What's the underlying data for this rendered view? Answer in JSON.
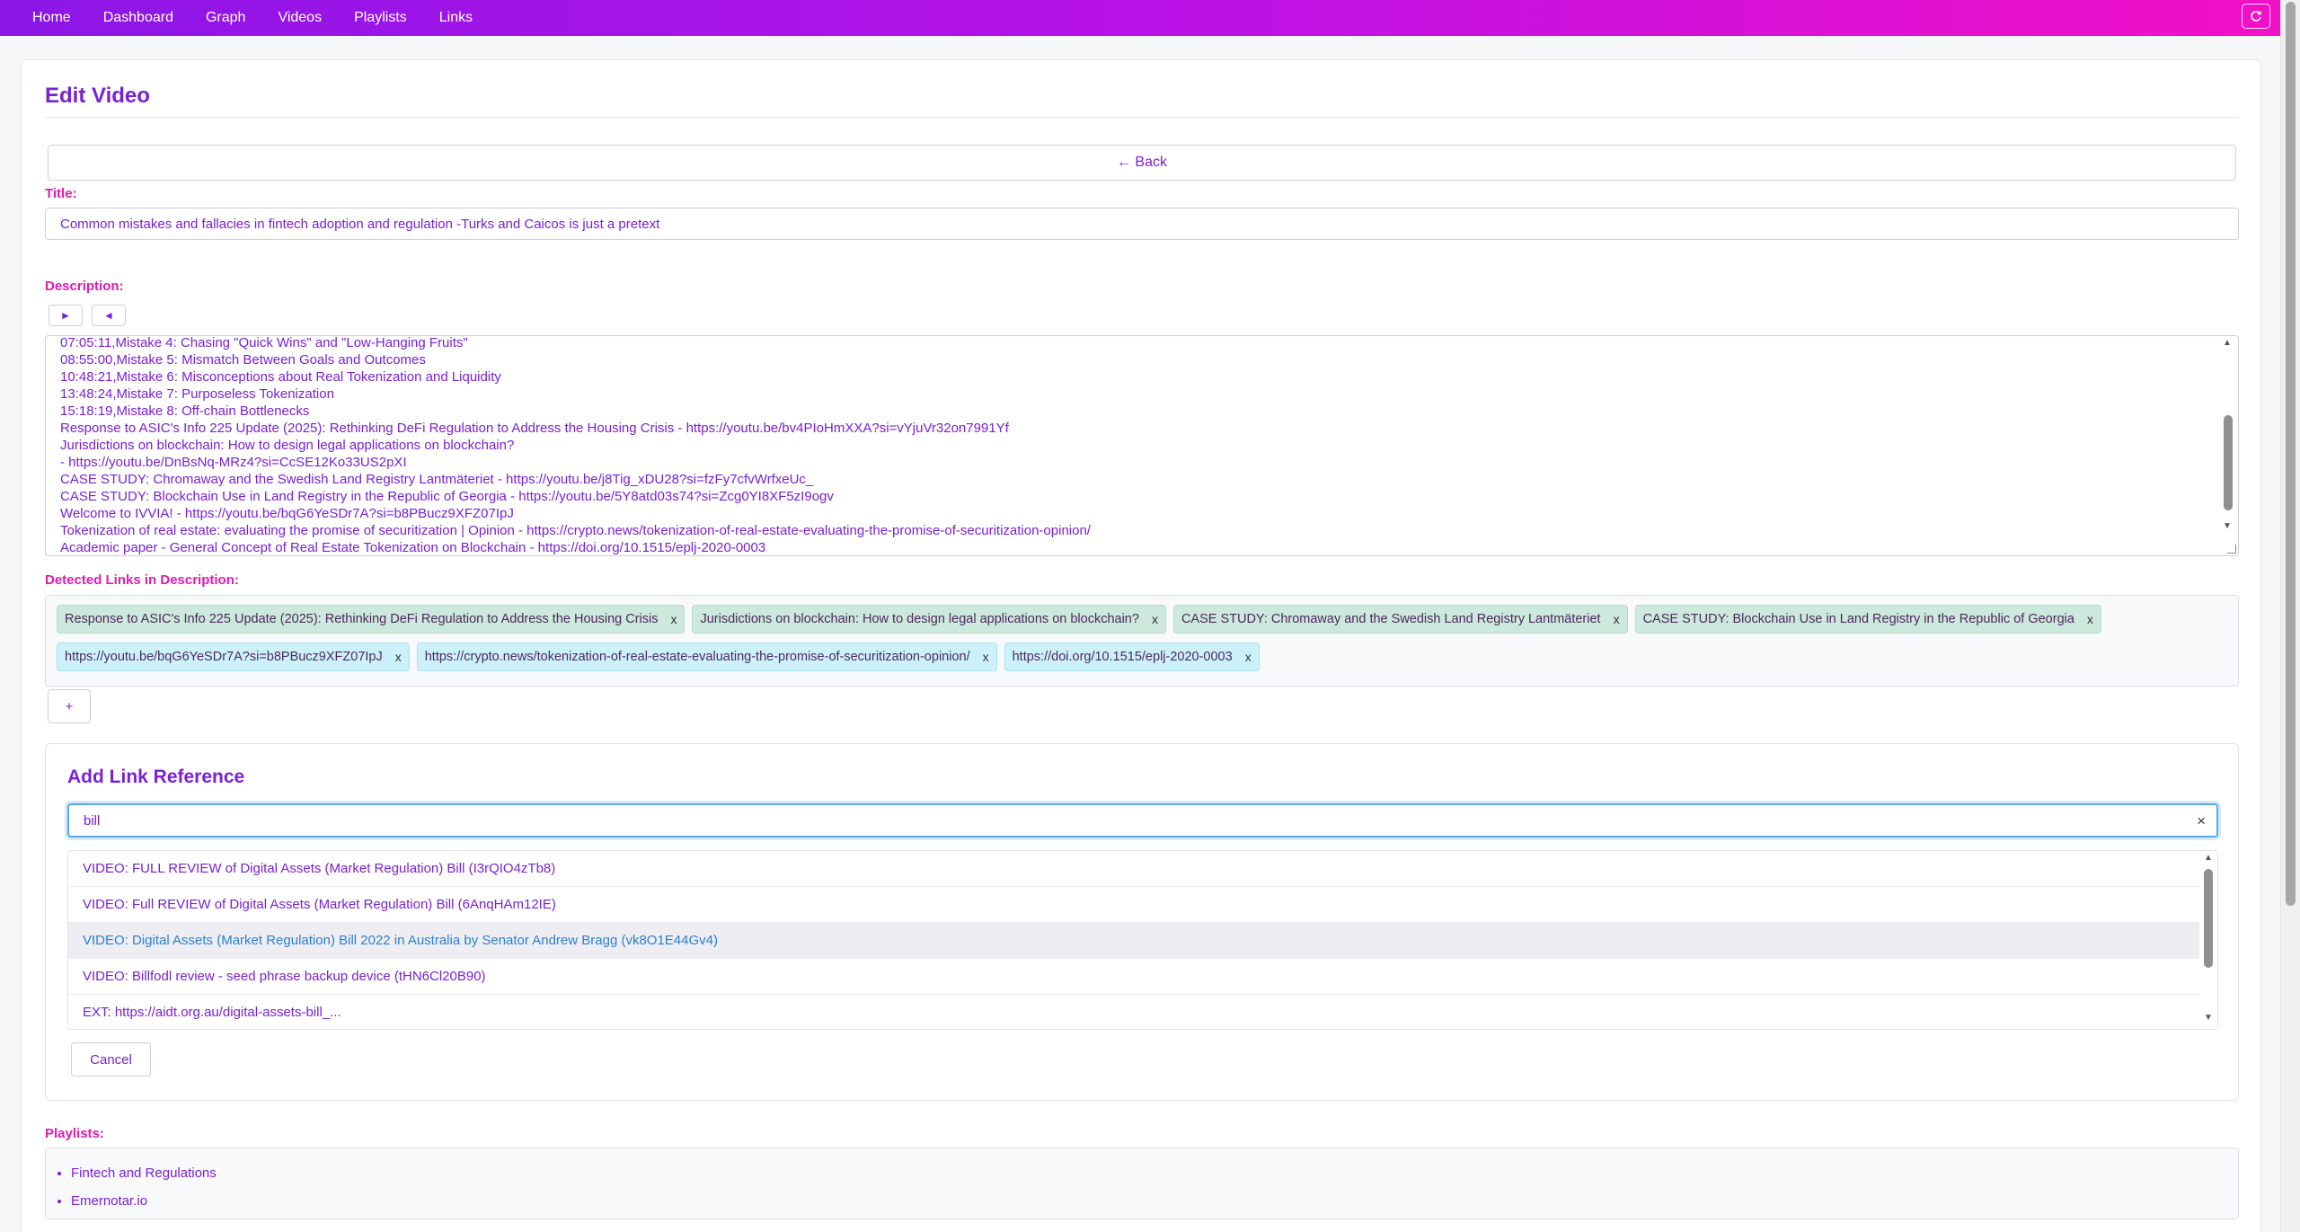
{
  "nav": {
    "items": [
      "Home",
      "Dashboard",
      "Graph",
      "Videos",
      "Playlists",
      "Links"
    ]
  },
  "page": {
    "title": "Edit Video",
    "back_label": "← Back",
    "title_label": "Title:",
    "title_value": "Common mistakes and fallacies in fintech adoption and regulation -Turks and Caicos is just a pretext",
    "description_label": "Description:",
    "expand_label": "►",
    "collapse_label": "◄",
    "description_lines": [
      "07:05:11,Mistake 4: Chasing \"Quick Wins\" and \"Low-Hanging Fruits\"",
      "08:55:00,Mistake 5: Mismatch Between Goals and Outcomes",
      "10:48:21,Mistake 6: Misconceptions about Real Tokenization and Liquidity",
      "13:48:24,Mistake 7: Purposeless Tokenization",
      "15:18:19,Mistake 8: Off-chain Bottlenecks",
      "Response to ASIC's Info 225 Update (2025): Rethinking DeFi Regulation to Address the Housing Crisis - https://youtu.be/bv4PIoHmXXA?si=vYjuVr32on7991Yf",
      "Jurisdictions on blockchain: How to design legal applications on blockchain?",
      "- https://youtu.be/DnBsNq-MRz4?si=CcSE12Ko33US2pXI",
      "CASE STUDY: Chromaway and the Swedish Land Registry Lantmäteriet - https://youtu.be/j8Tig_xDU28?si=fzFy7cfvWrfxeUc_",
      "CASE STUDY: Blockchain Use in Land Registry in the Republic of Georgia - https://youtu.be/5Y8atd03s74?si=Zcg0YI8XF5zI9ogv",
      "Welcome to IVVIA! - https://youtu.be/bqG6YeSDr7A?si=b8PBucz9XFZ07IpJ",
      "Tokenization of real estate: evaluating the promise of securitization | Opinion - https://crypto.news/tokenization-of-real-estate-evaluating-the-promise-of-securitization-opinion/",
      "Academic paper - General Concept of Real Estate Tokenization on Blockchain - https://doi.org/10.1515/eplj-2020-0003"
    ],
    "detected_links_label": "Detected Links in Description:",
    "detected_links": [
      {
        "label": "Response to ASIC's Info 225 Update (2025): Rethinking DeFi Regulation to Address the Housing Crisis",
        "kind": "video"
      },
      {
        "label": "Jurisdictions on blockchain: How to design legal applications on blockchain?",
        "kind": "video"
      },
      {
        "label": "CASE STUDY: Chromaway and the Swedish Land Registry Lantmäteriet",
        "kind": "video"
      },
      {
        "label": "CASE STUDY: Blockchain Use in Land Registry in the Republic of Georgia",
        "kind": "video"
      },
      {
        "label": "https://youtu.be/bqG6YeSDr7A?si=b8PBucz9XFZ07IpJ",
        "kind": "external"
      },
      {
        "label": "https://crypto.news/tokenization-of-real-estate-evaluating-the-promise-of-securitization-opinion/",
        "kind": "external"
      },
      {
        "label": "https://doi.org/10.1515/eplj-2020-0003",
        "kind": "external"
      }
    ],
    "chip_remove_label": "x",
    "add_button_label": "+",
    "add_link": {
      "title": "Add Link Reference",
      "search_value": "bill",
      "clear_label": "×",
      "results": [
        "VIDEO: FULL REVIEW of Digital Assets (Market Regulation) Bill (I3rQIO4zTb8)",
        "VIDEO: Full REVIEW of Digital Assets (Market Regulation) Bill (6AnqHAm12IE)",
        "VIDEO: Digital Assets (Market Regulation) Bill 2022 in Australia by Senator Andrew Bragg (vk8O1E44Gv4)",
        "VIDEO: Billfodl review - seed phrase backup device (tHN6Cl20B90)",
        "EXT: https://aidt.org.au/digital-assets-bill_..."
      ],
      "highlighted_index": 2,
      "cancel_label": "Cancel"
    },
    "playlists_label": "Playlists:",
    "playlists": [
      "Fintech and Regulations",
      "Emernotar.io"
    ]
  },
  "colors": {
    "nav_gradient_start": "#8b16e6",
    "nav_gradient_end": "#f210c6",
    "accent_text": "#7a1fd6",
    "label_pink": "#e01bb0",
    "chip_video": "#cde8dc",
    "chip_external": "#cdf1fb",
    "focus_ring": "#5aa7e6"
  },
  "icons": {
    "refresh": "refresh-icon"
  }
}
